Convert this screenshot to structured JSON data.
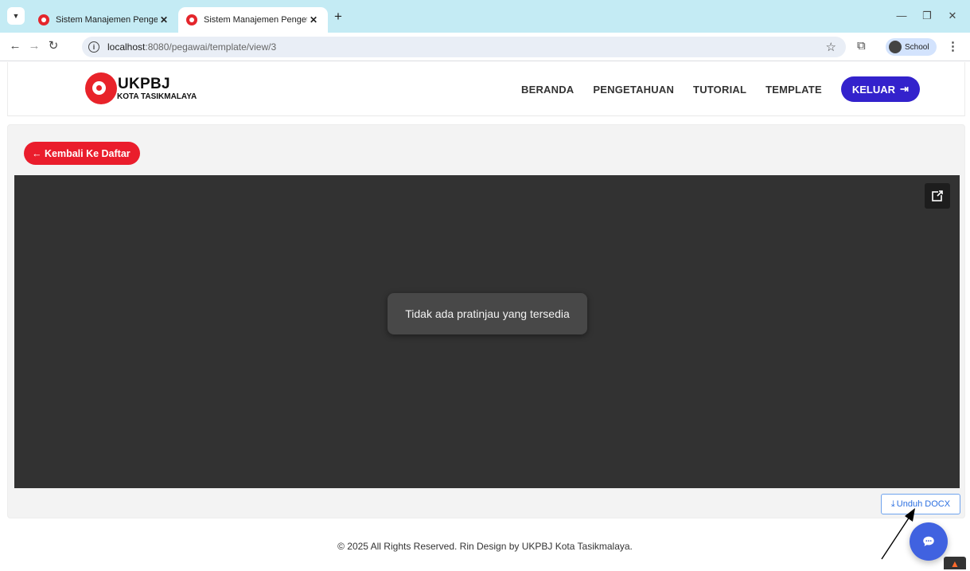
{
  "browser": {
    "tabs": [
      {
        "title": "Sistem Manajemen Pengetahuan",
        "active": false
      },
      {
        "title": "Sistem Manajemen Pengetahuan",
        "active": true
      }
    ],
    "url_host": "localhost",
    "url_path": ":8080/pegawai/template/view/3",
    "profile_label": "School"
  },
  "site": {
    "logo_top": "UKPBJ",
    "logo_bottom": "KOTA TASIKMALAYA",
    "nav": [
      "BERANDA",
      "PENGETAHUAN",
      "TUTORIAL",
      "TEMPLATE"
    ],
    "logout_label": "KELUAR",
    "brand_colors": {
      "red": "#e8232a",
      "indigo": "#3322cc",
      "blue": "#4062e0"
    }
  },
  "main": {
    "back_label": "← Kembali Ke Daftar",
    "no_preview_text": "Tidak ada pratinjau yang tersedia",
    "download_label": "Unduh DOCX"
  },
  "footer": {
    "text": "© 2025 All Rights Reserved. Rin Design by UKPBJ Kota Tasikmalaya."
  },
  "icons": {
    "tab_menu": "chevron-down-icon",
    "popout": "open-external-icon",
    "download": "download-icon",
    "chat": "chat-bubble-icon",
    "logout": "logout-icon"
  }
}
